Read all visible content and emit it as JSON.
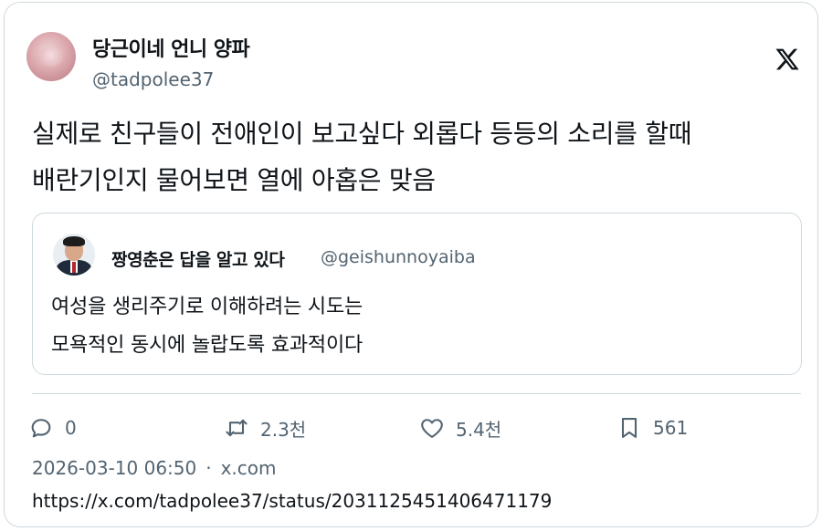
{
  "author": {
    "display_name": "당근이네 언니 양파",
    "handle": "@tadpolee37"
  },
  "tweet": {
    "text": "실제로 친구들이 전애인이 보고싶다 외롭다 등등의 소리를 할때\n배란기인지 물어보면 열에 아홉은 맞음"
  },
  "quoted": {
    "display_name": "짱영춘은 답을 알고 있다",
    "handle": "@geishunnoyaiba",
    "text": "여성을 생리주기로 이해하려는 시도는\n모욕적인 동시에 놀랍도록 효과적이다"
  },
  "actions": {
    "reply": {
      "icon": "reply-icon",
      "count": "0"
    },
    "retweet": {
      "icon": "retweet-icon",
      "count": "2.3천"
    },
    "like": {
      "icon": "heart-icon",
      "count": "5.4천"
    },
    "bookmark": {
      "icon": "bookmark-icon",
      "count": "561"
    }
  },
  "meta": {
    "timestamp": "2026-03-10 06:50",
    "separator": "·",
    "source": "x.com"
  },
  "url": "https://x.com/tadpolee37/status/2031125451406471179",
  "colors": {
    "text": "#0f1419",
    "secondary": "#536471",
    "border": "#cfd9de"
  }
}
